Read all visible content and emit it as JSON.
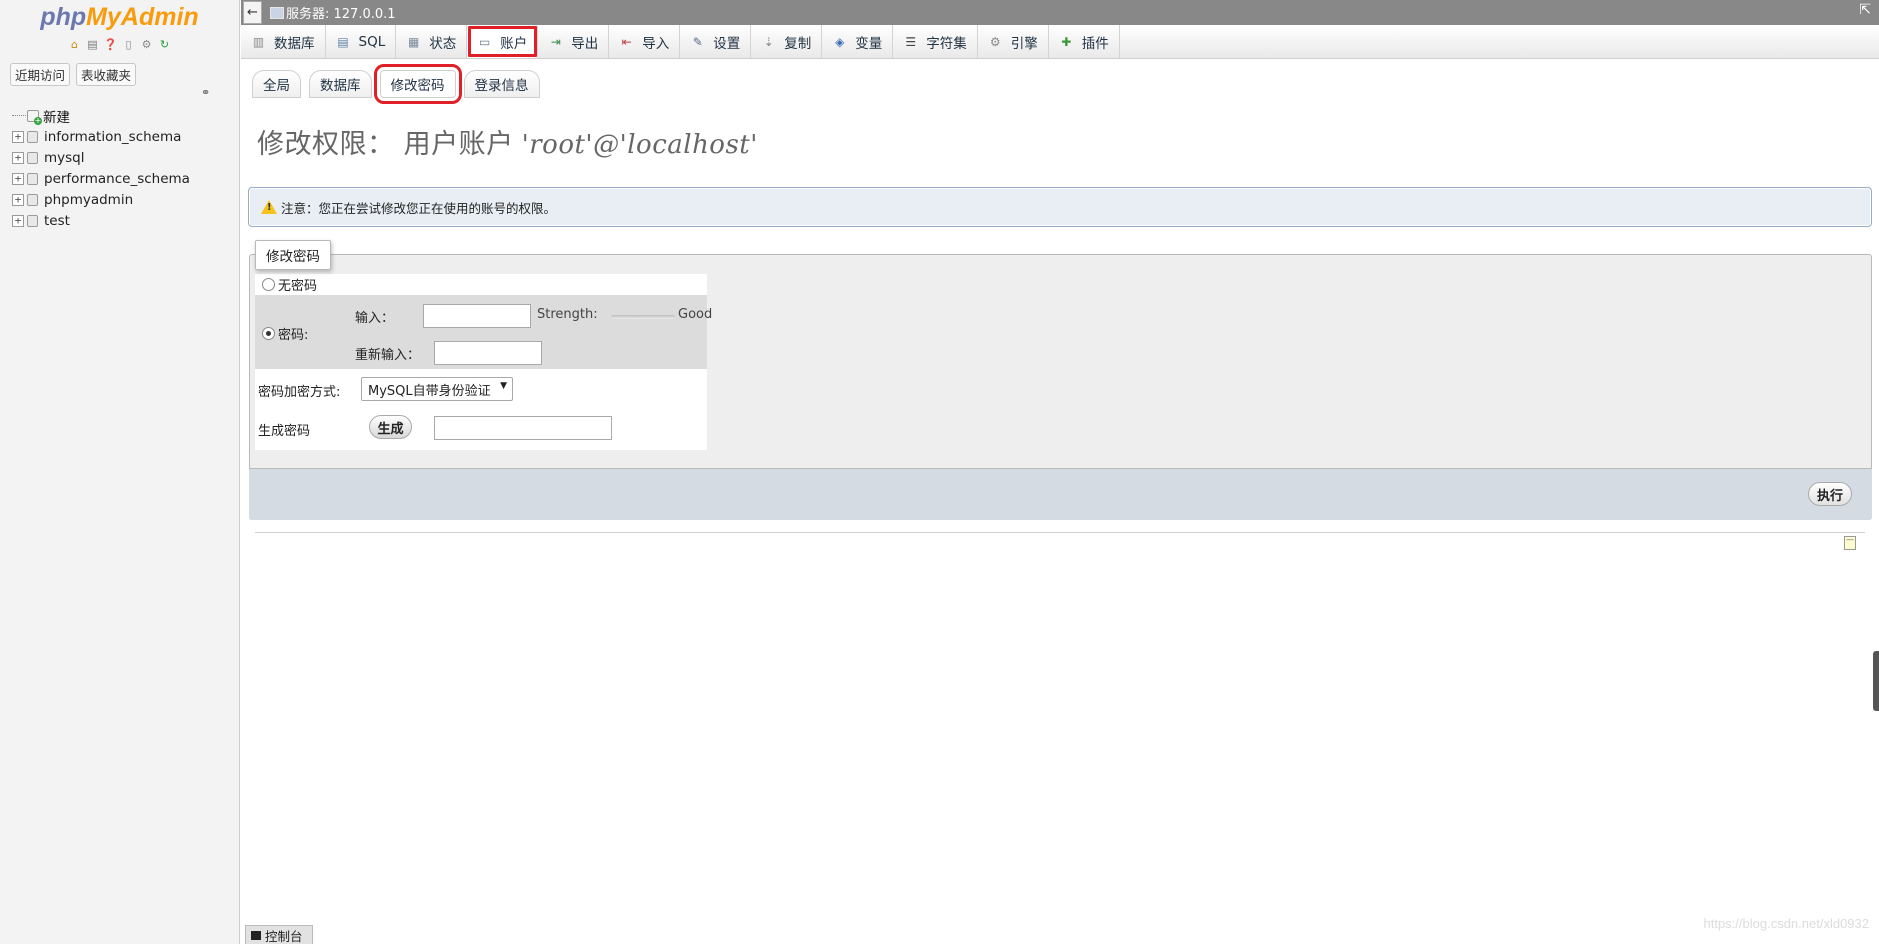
{
  "logo": {
    "php": "php",
    "myadmin": "MyAdmin"
  },
  "nav_tabs": {
    "recent": "近期访问",
    "favorites": "表收藏夹"
  },
  "tree": {
    "new_label": "新建",
    "databases": [
      "information_schema",
      "mysql",
      "performance_schema",
      "phpmyadmin",
      "test"
    ]
  },
  "topbar": {
    "back_icon": "←",
    "server": "服务器: 127.0.0.1",
    "collapse_icon": "⇱"
  },
  "menu": [
    {
      "label": "数据库",
      "icon": "database-icon"
    },
    {
      "label": "SQL",
      "icon": "sql-icon"
    },
    {
      "label": "状态",
      "icon": "status-icon"
    },
    {
      "label": "账户",
      "icon": "accounts-icon",
      "active": true
    },
    {
      "label": "导出",
      "icon": "export-icon"
    },
    {
      "label": "导入",
      "icon": "import-icon"
    },
    {
      "label": "设置",
      "icon": "settings-icon"
    },
    {
      "label": "复制",
      "icon": "replication-icon"
    },
    {
      "label": "变量",
      "icon": "variables-icon"
    },
    {
      "label": "字符集",
      "icon": "charset-icon"
    },
    {
      "label": "引擎",
      "icon": "engine-icon"
    },
    {
      "label": "插件",
      "icon": "plugin-icon"
    }
  ],
  "subtabs": [
    {
      "label": "全局"
    },
    {
      "label": "数据库"
    },
    {
      "label": "修改密码",
      "active": true
    },
    {
      "label": "登录信息"
    }
  ],
  "title": {
    "prefix": "修改权限：  用户账户",
    "account": "'root'@'localhost'"
  },
  "notice": "注意：您正在尝试修改您正在使用的账号的权限。",
  "form": {
    "legend": "修改密码",
    "no_password": "无密码",
    "password": "密码:",
    "enter": "输入：",
    "reenter": "重新输入：",
    "strength_label": "Strength:",
    "strength_value": "Good",
    "hashing_label": "密码加密方式:",
    "hashing_value": "MySQL自带身份验证",
    "generate_label": "生成密码",
    "generate_button": "生成",
    "go_button": "执行"
  },
  "console": "控制台",
  "watermark": "https://blog.csdn.net/xld0932"
}
